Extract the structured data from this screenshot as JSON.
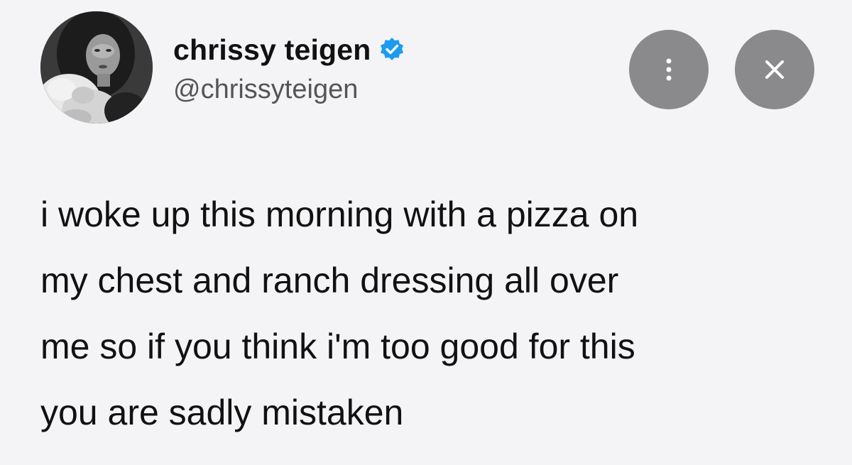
{
  "profile": {
    "display_name": "chrissy teigen",
    "handle": "@chrissyteigen",
    "verified": true,
    "avatar_icon": "profile-photo"
  },
  "actions": {
    "more_icon": "more-options-icon",
    "close_icon": "close-icon"
  },
  "tweet": {
    "lines": [
      "i woke up this morning with a pizza on",
      "my chest and ranch dressing all over",
      "me so if you think i'm too good for this",
      "you are sadly mistaken"
    ]
  },
  "colors": {
    "background": "#f4f4f6",
    "verified_badge": "#1d9bf0",
    "action_button": "#8a8a8c"
  }
}
